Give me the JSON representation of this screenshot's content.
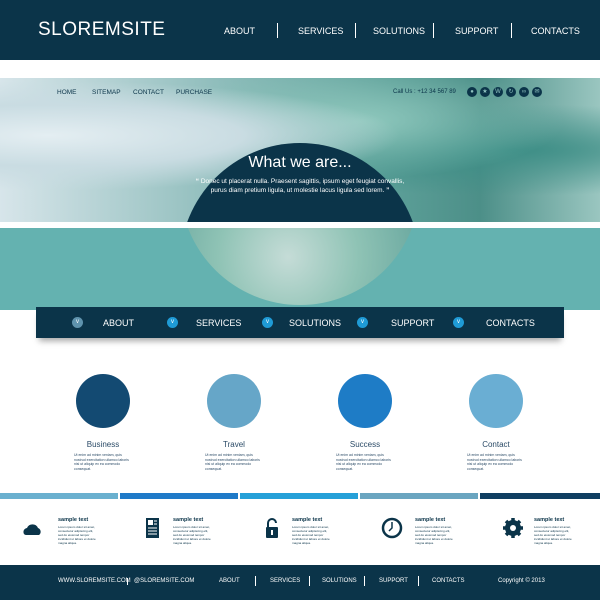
{
  "header": {
    "logo": "SLOREMSITE",
    "nav": [
      "ABOUT",
      "SERVICES",
      "SOLUTIONS",
      "SUPPORT",
      "CONTACTS"
    ]
  },
  "subnav": {
    "links": [
      "HOME",
      "SITEMAP",
      "CONTACT",
      "PURCHASE"
    ],
    "call": "Call Us : +12 34 567 89",
    "social_icons": [
      "drop-icon",
      "star-icon",
      "w-icon",
      "refresh-icon",
      "link-icon",
      "mail-icon"
    ]
  },
  "hero": {
    "title": "What we are...",
    "quote": "Donec ut placerat nulla. Praesent sagittis, ipsum eget feugiat convallis, purus diam pretium ligula, ut molestie lacus ligula sed lorem.",
    "open_quote": "“",
    "close_quote": "”"
  },
  "mainnav": [
    "ABOUT",
    "SERVICES",
    "SOLUTIONS",
    "SUPPORT",
    "CONTACTS"
  ],
  "features": [
    {
      "title": "Business",
      "text": "Ut enim ad minim veniam, quis nostrud exercitation ullamco laboris nisi ut aliquip ex ea commodo consequat.",
      "color": "#134a72"
    },
    {
      "title": "Travel",
      "text": "Ut enim ad minim veniam, quis nostrud exercitation ullamco laboris nisi ut aliquip ex ea commodo consequat.",
      "color": "#66a6c8"
    },
    {
      "title": "Success",
      "text": "Ut enim ad minim veniam, quis nostrud exercitation ullamco laboris nisi ut aliquip ex ea commodo consequat.",
      "color": "#1e7cc6"
    },
    {
      "title": "Contact",
      "text": "Ut enim ad minim veniam, quis nostrud exercitation ullamco laboris nisi ut aliquip ex ea commodo consequat.",
      "color": "#6aaed3"
    }
  ],
  "bars": [
    "#6ab0cf",
    "#1f7ac8",
    "#26a0d8",
    "#6aa5c0",
    "#0f3e61"
  ],
  "services": [
    {
      "icon": "cloud-icon",
      "title": "sample text",
      "text": "Lorem ipsum dolor sit amet, consectetur adipiscing elit, sed do eiusmod tempor incididunt ut labore et dolore magna aliqua."
    },
    {
      "icon": "document-icon",
      "title": "sample text",
      "text": "Lorem ipsum dolor sit amet, consectetur adipiscing elit, sed do eiusmod tempor incididunt ut labore et dolore magna aliqua."
    },
    {
      "icon": "lock-icon",
      "title": "sample text",
      "text": "Lorem ipsum dolor sit amet, consectetur adipiscing elit, sed do eiusmod tempor incididunt ut labore et dolore magna aliqua."
    },
    {
      "icon": "clock-icon",
      "title": "sample text",
      "text": "Lorem ipsum dolor sit amet, consectetur adipiscing elit, sed do eiusmod tempor incididunt ut labore et dolore magna aliqua."
    },
    {
      "icon": "gear-icon",
      "title": "sample text",
      "text": "Lorem ipsum dolor sit amet, consectetur adipiscing elit, sed do eiusmod tempor incididunt ut labore et dolore magna aliqua."
    }
  ],
  "footer": {
    "website": "WWW.SLOREMSITE.COM",
    "handle": "@SLOREMSITE.COM",
    "nav": [
      "ABOUT",
      "SERVICES",
      "SOLUTIONS",
      "SUPPORT",
      "CONTACTS"
    ],
    "copyright": "Copyright © 2013"
  },
  "colors": {
    "primary": "#0b3449",
    "teal": "#64b2b0",
    "accent": "#1f9bd6"
  }
}
